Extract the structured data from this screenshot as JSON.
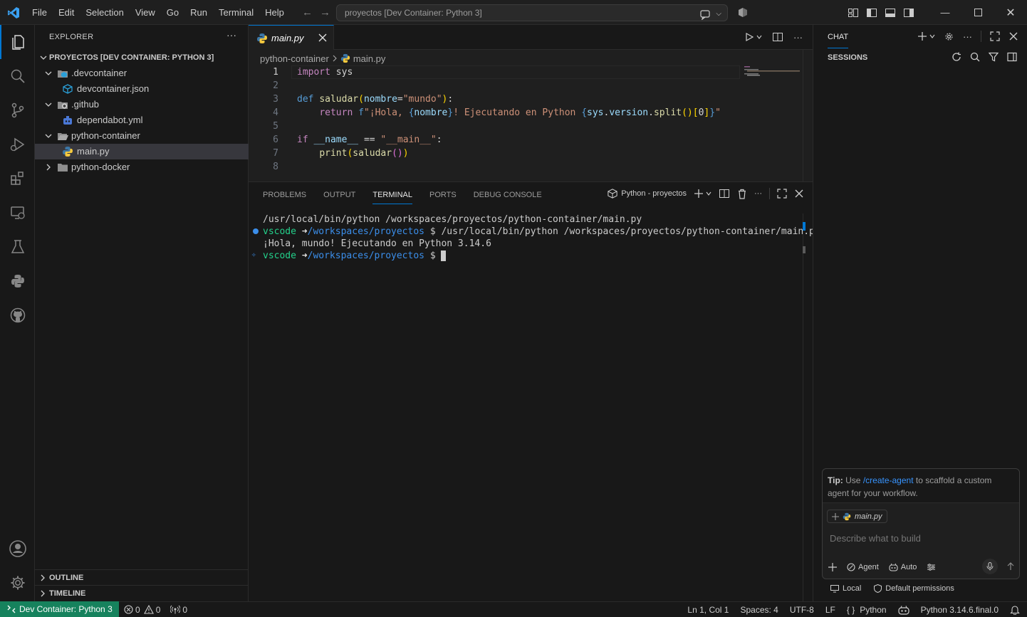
{
  "titlebar": {
    "menu": [
      "File",
      "Edit",
      "Selection",
      "View",
      "Go",
      "Run",
      "Terminal",
      "Help"
    ],
    "command_center": "proyectos [Dev Container: Python 3]"
  },
  "explorer": {
    "title": "EXPLORER",
    "root": "PROYECTOS [DEV CONTAINER: PYTHON 3]",
    "items": [
      {
        "label": ".devcontainer",
        "type": "folder",
        "expanded": true,
        "depth": 1
      },
      {
        "label": "devcontainer.json",
        "type": "file",
        "depth": 2
      },
      {
        "label": ".github",
        "type": "folder",
        "expanded": true,
        "depth": 1
      },
      {
        "label": "dependabot.yml",
        "type": "file",
        "depth": 2
      },
      {
        "label": "python-container",
        "type": "folder",
        "expanded": true,
        "depth": 1
      },
      {
        "label": "main.py",
        "type": "file",
        "depth": 2,
        "selected": true
      },
      {
        "label": "python-docker",
        "type": "folder",
        "expanded": false,
        "depth": 1
      }
    ],
    "outline": "OUTLINE",
    "timeline": "TIMELINE"
  },
  "editor": {
    "tab": "main.py",
    "breadcrumb": [
      "python-container",
      "main.py"
    ],
    "line_numbers": [
      "1",
      "2",
      "3",
      "4",
      "5",
      "6",
      "7",
      "8"
    ],
    "code_lines": [
      "import sys",
      "",
      "def saludar(nombre=\"mundo\"):",
      "    return f\"¡Hola, {nombre}! Ejecutando en Python {sys.version.split()[0]}\"",
      "",
      "if __name__ == \"__main__\":",
      "    print(saludar())",
      ""
    ]
  },
  "panel": {
    "tabs": [
      "PROBLEMS",
      "OUTPUT",
      "TERMINAL",
      "PORTS",
      "DEBUG CONSOLE"
    ],
    "active_tab": "TERMINAL",
    "terminal_name": "Python - proyectos",
    "terminal": {
      "line1": "/usr/local/bin/python /workspaces/proyectos/python-container/main.py",
      "prompt_user": "vscode",
      "prompt_arrow": "➜",
      "prompt_path": "/workspaces/proyectos",
      "prompt_sign": "$",
      "line2_cmd": "/usr/local/bin/python /workspaces/proyectos/python-container/main.py",
      "line3": "¡Hola, mundo! Ejecutando en Python 3.14.6"
    }
  },
  "chat": {
    "title": "CHAT",
    "sessions": "SESSIONS",
    "tip_label": "Tip:",
    "tip_pre": "Use",
    "tip_link": "/create-agent",
    "tip_post": "to scaffold a custom agent for your workflow.",
    "attachment": "main.py",
    "placeholder": "Describe what to build",
    "mode": "Agent",
    "model": "Auto",
    "footer_local": "Local",
    "footer_permissions": "Default permissions"
  },
  "statusbar": {
    "remote": "Dev Container: Python 3",
    "errors": "0",
    "warnings": "0",
    "ports": "0",
    "position": "Ln 1, Col 1",
    "spaces": "Spaces: 4",
    "encoding": "UTF-8",
    "eol": "LF",
    "language": "Python",
    "interpreter": "Python 3.14.6.final.0"
  },
  "colors": {
    "accent": "#0078d4",
    "remote": "#16825d"
  }
}
